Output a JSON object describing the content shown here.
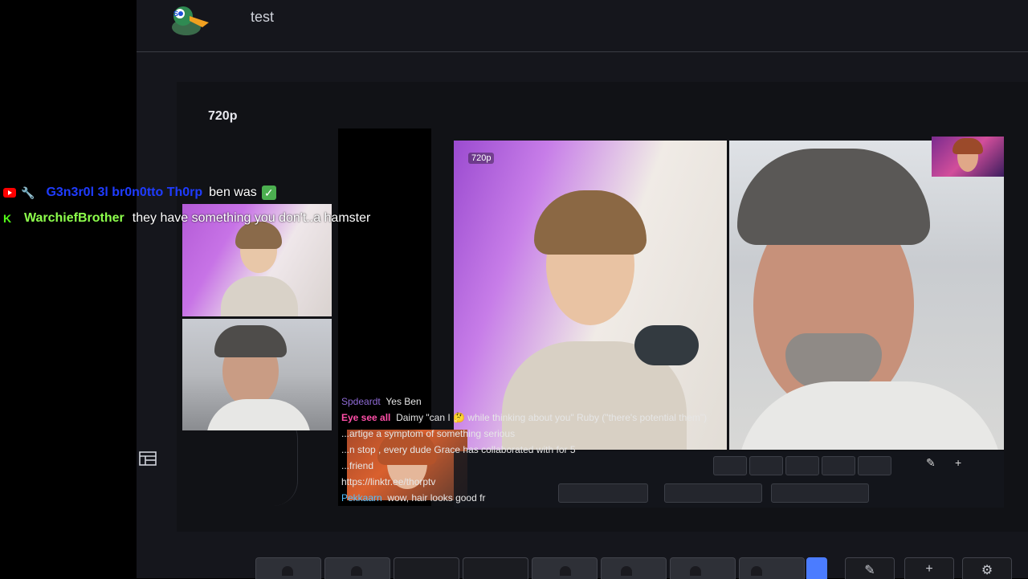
{
  "app": {
    "title": "test"
  },
  "canvas": {
    "resolution_label": "720p"
  },
  "chat": [
    {
      "platform": "youtube",
      "username": "G3n3r0l 3l br0n0tto Th0rp",
      "message": "ben was",
      "emoji": "✅"
    },
    {
      "platform": "kick",
      "username": "WarchiefBrother",
      "message": "they have something you don't..a hamster"
    }
  ],
  "video": {
    "cam_resolution_tag": "720p",
    "feed": [
      {
        "user": "Spdeardt",
        "text": "Yes Ben"
      },
      {
        "user": "Eye see all",
        "text": "Daimy \"can I 🤔 while thinking about you\" Ruby (\"there's potential them\")"
      },
      {
        "user": "",
        "text": "...artige a symptom of something serious"
      },
      {
        "user": "",
        "text": "...n stop , every dude Grace has collaborated with for 5"
      },
      {
        "user": "",
        "text": "...friend"
      },
      {
        "user": "",
        "text": "https://linktr.ee/thorptv"
      },
      {
        "user": "Pekkaarn",
        "text": "wow, hair looks good fr"
      }
    ]
  },
  "bottom_toolbar": {
    "buttons": [
      {
        "name": "layout-single-person"
      },
      {
        "name": "layout-person-screen"
      },
      {
        "name": "layout-blank-1"
      },
      {
        "name": "layout-blank-2"
      },
      {
        "name": "layout-two-person-screen"
      },
      {
        "name": "layout-two-person"
      },
      {
        "name": "layout-split-people"
      },
      {
        "name": "layout-group"
      },
      {
        "name": "layout-active"
      },
      {
        "name": "edit"
      },
      {
        "name": "add"
      },
      {
        "name": "settings"
      }
    ]
  }
}
